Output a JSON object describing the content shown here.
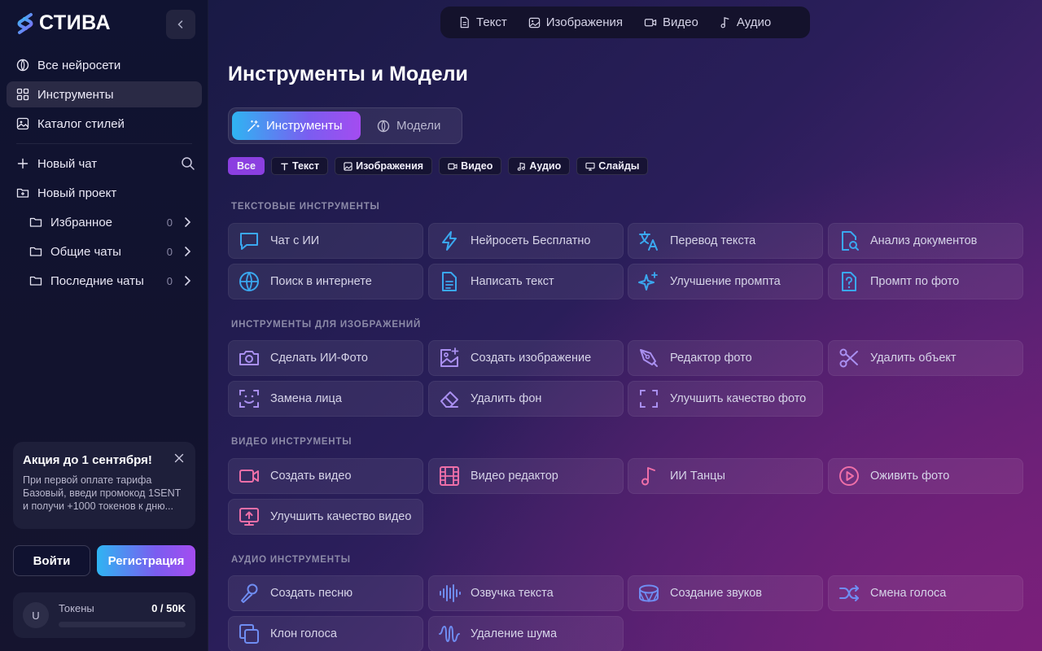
{
  "app": {
    "brand": "СТИВА"
  },
  "sidebar": {
    "nav": [
      {
        "label": "Все нейросети",
        "icon": "globe-icon"
      },
      {
        "label": "Инструменты",
        "icon": "grid-icon"
      },
      {
        "label": "Каталог стилей",
        "icon": "image-gallery-icon"
      }
    ],
    "new_chat": "Новый чат",
    "new_project": "Новый проект",
    "folders": [
      {
        "label": "Избранное",
        "count": "0"
      },
      {
        "label": "Общие чаты",
        "count": "0"
      },
      {
        "label": "Последние чаты",
        "count": "0"
      }
    ],
    "promo": {
      "title": "Акция до 1 сентября!",
      "text": "При первой оплате тарифа Базовый, введи промокод 1SENT и получи +1000 токенов к дню..."
    },
    "login": "Войти",
    "register": "Регистрация",
    "tokens": {
      "avatar": "U",
      "label": "Токены",
      "value": "0 / 50K",
      "fill_fraction": 0
    }
  },
  "top_tabs": [
    {
      "label": "Текст",
      "icon": "document-icon"
    },
    {
      "label": "Изображения",
      "icon": "image-sparkle-icon"
    },
    {
      "label": "Видео",
      "icon": "video-icon"
    },
    {
      "label": "Аудио",
      "icon": "music-note-icon"
    }
  ],
  "main": {
    "title": "Инструменты и Модели",
    "segment": {
      "tools": "Инструменты",
      "models": "Модели"
    },
    "filters": [
      "Все",
      "Текст",
      "Изображения",
      "Видео",
      "Аудио",
      "Слайды"
    ],
    "sections": [
      {
        "label": "ТЕКСТОВЫЕ ИНСТРУМЕНТЫ",
        "color": "#3aa8f0",
        "tools": [
          {
            "label": "Чат с ИИ",
            "icon": "chat-icon"
          },
          {
            "label": "Нейросеть Бесплатно",
            "icon": "lightning-icon"
          },
          {
            "label": "Перевод текста",
            "icon": "translate-icon"
          },
          {
            "label": "Анализ документов",
            "icon": "document-search-icon"
          },
          {
            "label": "Поиск в интернете",
            "icon": "globe-icon"
          },
          {
            "label": "Написать текст",
            "icon": "document-text-icon"
          },
          {
            "label": "Улучшение промпта",
            "icon": "sparkles-icon"
          },
          {
            "label": "Промпт по фото",
            "icon": "document-question-icon"
          }
        ]
      },
      {
        "label": "ИНСТРУМЕНТЫ ДЛЯ ИЗОБРАЖЕНИЙ",
        "color": "#a98ff0",
        "tools": [
          {
            "label": "Сделать ИИ-Фото",
            "icon": "camera-icon"
          },
          {
            "label": "Создать изображение",
            "icon": "image-add-icon"
          },
          {
            "label": "Редактор фото",
            "icon": "pen-tool-icon"
          },
          {
            "label": "Удалить объект",
            "icon": "scissors-icon"
          },
          {
            "label": "Замена лица",
            "icon": "face-scan-icon"
          },
          {
            "label": "Удалить фон",
            "icon": "eraser-icon"
          },
          {
            "label": "Улучшить качество фото",
            "icon": "enhance-frame-icon"
          }
        ]
      },
      {
        "label": "ВИДЕО ИНСТРУМЕНТЫ",
        "color": "#ee6fa8",
        "tools": [
          {
            "label": "Создать видео",
            "icon": "video-camera-icon"
          },
          {
            "label": "Видео редактор",
            "icon": "film-icon"
          },
          {
            "label": "ИИ Танцы",
            "icon": "music-note-icon"
          },
          {
            "label": "Оживить фото",
            "icon": "play-circle-icon"
          },
          {
            "label": "Улучшить качество видео",
            "icon": "monitor-upload-icon"
          }
        ]
      },
      {
        "label": "АУДИО ИНСТРУМЕНТЫ",
        "color": "#6f8df2",
        "tools": [
          {
            "label": "Создать песню",
            "icon": "microphone-icon"
          },
          {
            "label": "Озвучка текста",
            "icon": "audio-wave-icon"
          },
          {
            "label": "Создание звуков",
            "icon": "drum-icon"
          },
          {
            "label": "Смена голоса",
            "icon": "shuffle-icon"
          },
          {
            "label": "Клон голоса",
            "icon": "copy-icon"
          },
          {
            "label": "Удаление шума",
            "icon": "noise-wave-icon"
          }
        ]
      }
    ]
  }
}
